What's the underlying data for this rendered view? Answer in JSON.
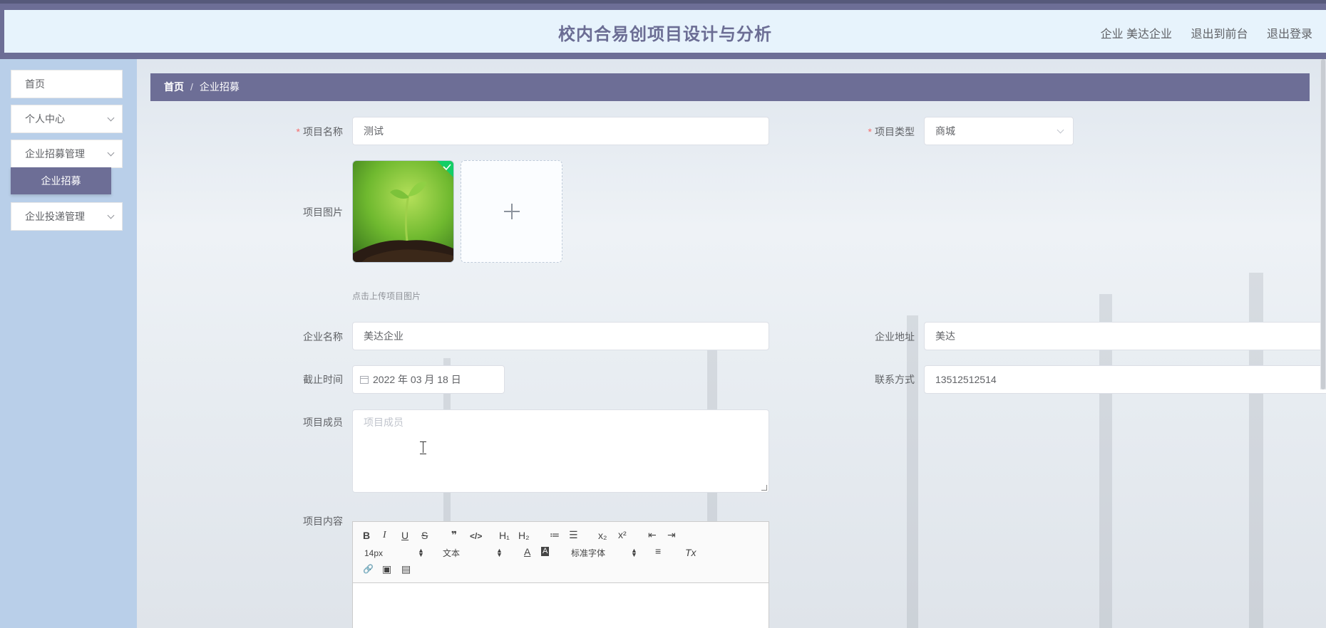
{
  "header": {
    "title": "校内合易创项目设计与分析",
    "user_label": "企业 美达企业",
    "to_frontend": "退出到前台",
    "logout": "退出登录"
  },
  "sidebar": {
    "items": [
      {
        "label": "首页"
      },
      {
        "label": "个人中心"
      },
      {
        "label": "企业招募管理"
      },
      {
        "label": "企业招募"
      },
      {
        "label": "企业投递管理"
      }
    ]
  },
  "breadcrumb": {
    "home": "首页",
    "separator": "/",
    "current": "企业招募"
  },
  "form": {
    "required_mark": "*",
    "project_name": {
      "label": "项目名称",
      "value": "测试"
    },
    "project_type": {
      "label": "项目类型",
      "value": "商城"
    },
    "project_image": {
      "label": "项目图片",
      "hint": "点击上传项目图片"
    },
    "company_name": {
      "label": "企业名称",
      "value": "美达企业"
    },
    "company_address": {
      "label": "企业地址",
      "value": "美达"
    },
    "deadline": {
      "label": "截止时间",
      "value": "2022 年 03 月 18 日"
    },
    "contact": {
      "label": "联系方式",
      "value": "13512512514"
    },
    "members": {
      "label": "项目成员",
      "placeholder": "项目成员"
    },
    "content": {
      "label": "项目内容"
    }
  },
  "editor": {
    "bold": "B",
    "italic": "I",
    "underline": "U",
    "strike": "S",
    "blockquote": "❞",
    "code": "</>",
    "h1": "H₁",
    "h2": "H₂",
    "ordered_list": "≔",
    "bullet_list": "☰",
    "subscript": "x₂",
    "superscript": "x²",
    "outdent": "⇤",
    "indent": "⇥",
    "font_size": "14px",
    "text_style": "文本",
    "font_color": "A",
    "background": "A",
    "font_family": "标准字体",
    "align": "≡",
    "clean": "Tx",
    "link": "🔗",
    "image": "▣",
    "video": "▤"
  },
  "colors": {
    "accent": "#6d6e96",
    "sidebar_bg": "#b9cfe9",
    "header_bg": "#e7f3fc",
    "required": "#f56c6c",
    "success": "#13ce66"
  }
}
